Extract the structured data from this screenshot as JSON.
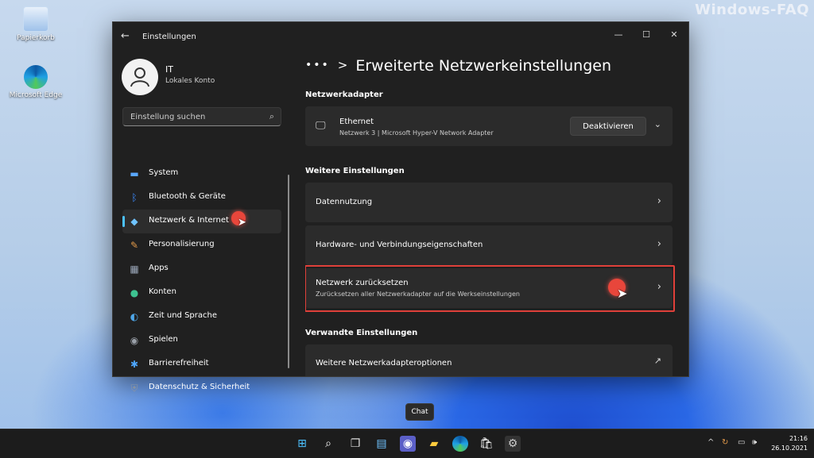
{
  "watermark": "Windows-FAQ",
  "desktop": {
    "icons": [
      {
        "label": "Papierkorb"
      },
      {
        "label": "Microsoft Edge"
      }
    ]
  },
  "window": {
    "title": "Einstellungen",
    "controls": {
      "minimize": "—",
      "maximize": "☐",
      "close": "✕"
    }
  },
  "user": {
    "name": "IT",
    "account_type": "Lokales Konto"
  },
  "search": {
    "placeholder": "Einstellung suchen"
  },
  "sidebar": {
    "items": [
      {
        "label": "System",
        "icon": "monitor-icon",
        "color": "#5aa7ff"
      },
      {
        "label": "Bluetooth & Geräte",
        "icon": "bluetooth-icon",
        "color": "#3c8cff"
      },
      {
        "label": "Netzwerk & Internet",
        "icon": "wifi-icon",
        "color": "#6fc3ff"
      },
      {
        "label": "Personalisierung",
        "icon": "brush-icon",
        "color": "#e39a4a"
      },
      {
        "label": "Apps",
        "icon": "apps-icon",
        "color": "#9aa6b8"
      },
      {
        "label": "Konten",
        "icon": "person-icon",
        "color": "#3dc290"
      },
      {
        "label": "Zeit und Sprache",
        "icon": "globe-icon",
        "color": "#4ea6e8"
      },
      {
        "label": "Spielen",
        "icon": "gamepad-icon",
        "color": "#9aa0a8"
      },
      {
        "label": "Barrierefreiheit",
        "icon": "accessibility-icon",
        "color": "#4ea6ff"
      },
      {
        "label": "Datenschutz & Sicherheit",
        "icon": "shield-icon",
        "color": "#8c949e"
      }
    ],
    "active_index": 2
  },
  "main": {
    "breadcrumb": {
      "ellipsis": "•••",
      "separator": ">",
      "title": "Erweiterte Netzwerkeinstellungen"
    },
    "sections": {
      "adapters": "Netzwerkadapter",
      "more": "Weitere Einstellungen",
      "related": "Verwandte Einstellungen"
    },
    "adapter": {
      "name": "Ethernet",
      "detail": "Netzwerk 3 | Microsoft Hyper-V Network Adapter",
      "button": "Deaktivieren"
    },
    "more_items": [
      {
        "title": "Datennutzung"
      },
      {
        "title": "Hardware- und Verbindungseigenschaften"
      },
      {
        "title": "Netzwerk zurücksetzen",
        "subtitle": "Zurücksetzen aller Netzwerkadapter auf die Werkseinstellungen"
      }
    ],
    "related_items": [
      {
        "title": "Weitere Netzwerkadapteroptionen"
      }
    ]
  },
  "tooltip": "Chat",
  "taskbar": {
    "time": "21:16",
    "date": "26.10.2021"
  }
}
